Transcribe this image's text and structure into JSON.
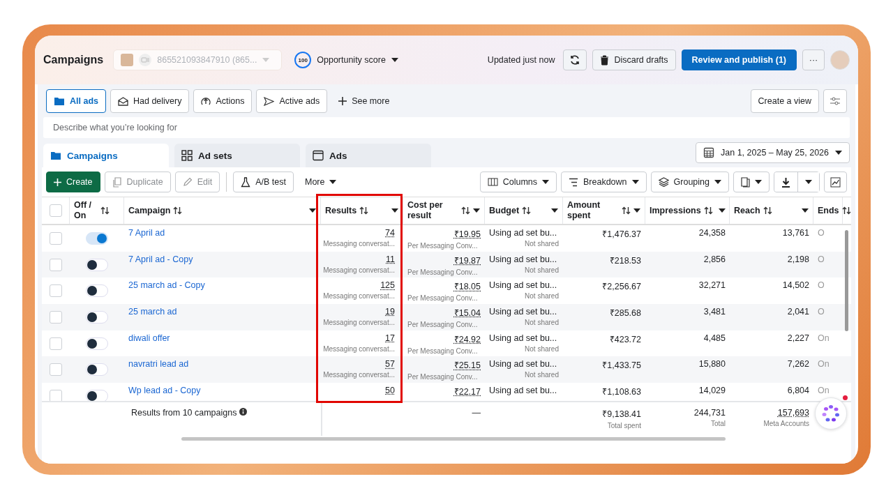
{
  "header": {
    "title": "Campaigns",
    "account": "865521093847910 (865...",
    "score_badge": "100",
    "score_label": "Opportunity score",
    "updated": "Updated just now",
    "discard": "Discard drafts",
    "publish": "Review and publish (1)",
    "more": "···"
  },
  "filters": [
    {
      "label": "All ads",
      "selected": true
    },
    {
      "label": "Had delivery",
      "selected": false
    },
    {
      "label": "Actions",
      "selected": false
    },
    {
      "label": "Active ads",
      "selected": false
    }
  ],
  "see_more": "See more",
  "create_view": "Create a view",
  "search": {
    "placeholder": "Describe what you’re looking for"
  },
  "level_tabs": [
    {
      "label": "Campaigns",
      "selected": true
    },
    {
      "label": "Ad sets",
      "selected": false
    },
    {
      "label": "Ads",
      "selected": false
    }
  ],
  "date_range": "Jan 1, 2025 – May 25, 2026",
  "toolbar": {
    "create": "Create",
    "duplicate": {
      "label": "Duplicate",
      "disabled": true
    },
    "edit": {
      "label": "Edit",
      "disabled": true
    },
    "ab_test": "A/B test",
    "more": "More",
    "columns": "Columns",
    "breakdown": "Breakdown",
    "grouping": "Grouping"
  },
  "table": {
    "select_all_checked": false,
    "columns": [
      "Off / On",
      "Campaign",
      "Results",
      "Cost per result",
      "Budget",
      "Amount spent",
      "Impressions",
      "Reach",
      "Ends"
    ],
    "rows": [
      {
        "checked": false,
        "on": true,
        "campaign": "7 April ad",
        "results": "74",
        "results_sub": "Messaging conversat...",
        "cost": "₹19.95",
        "cost_sub": "Per Messaging Conv...",
        "budget": "Using ad set bu...",
        "budget_sub": "Not shared",
        "amount": "₹1,476.37",
        "impressions": "24,358",
        "reach": "13,761",
        "ends": "O"
      },
      {
        "checked": false,
        "on": false,
        "campaign": "7 April ad - Copy",
        "results": "11",
        "results_sub": "Messaging conversat...",
        "cost": "₹19.87",
        "cost_sub": "Per Messaging Conv...",
        "budget": "Using ad set bu...",
        "budget_sub": "Not shared",
        "amount": "₹218.53",
        "impressions": "2,856",
        "reach": "2,198",
        "ends": "O"
      },
      {
        "checked": false,
        "on": false,
        "campaign": "25 march ad - Copy",
        "results": "125",
        "results_sub": "Messaging conversat...",
        "cost": "₹18.05",
        "cost_sub": "Per Messaging Conv...",
        "budget": "Using ad set bu...",
        "budget_sub": "Not shared",
        "amount": "₹2,256.67",
        "impressions": "32,271",
        "reach": "14,502",
        "ends": "O"
      },
      {
        "checked": false,
        "on": false,
        "campaign": "25 march ad",
        "results": "19",
        "results_sub": "Messaging conversat...",
        "cost": "₹15.04",
        "cost_sub": "Per Messaging Conv...",
        "budget": "Using ad set bu...",
        "budget_sub": "Not shared",
        "amount": "₹285.68",
        "impressions": "3,481",
        "reach": "2,041",
        "ends": "O"
      },
      {
        "checked": false,
        "on": false,
        "campaign": "diwali offer",
        "results": "17",
        "results_sub": "Messaging conversat...",
        "cost": "₹24.92",
        "cost_sub": "Per Messaging Conv...",
        "budget": "Using ad set bu...",
        "budget_sub": "Not shared",
        "amount": "₹423.72",
        "impressions": "4,485",
        "reach": "2,227",
        "ends": "On"
      },
      {
        "checked": false,
        "on": false,
        "campaign": "navratri lead ad",
        "results": "57",
        "results_sub": "Messaging conversat...",
        "cost": "₹25.15",
        "cost_sub": "Per Messaging Conv...",
        "budget": "Using ad set bu...",
        "budget_sub": "Not shared",
        "amount": "₹1,433.75",
        "impressions": "15,880",
        "reach": "7,262",
        "ends": "On"
      },
      {
        "checked": false,
        "on": false,
        "campaign": "Wp lead ad - Copy",
        "results": "50",
        "cost": "₹22.17",
        "budget": "Using ad set bu...",
        "amount": "₹1,108.63",
        "impressions": "14,029",
        "reach": "6,804",
        "ends": "On"
      }
    ],
    "footer": {
      "label": "Results from 10 campaigns",
      "cost": "—",
      "amount": "₹9,138.41",
      "amount_sub": "Total spent",
      "impressions": "244,731",
      "impressions_sub": "Total",
      "reach": "157,693",
      "reach_sub": "Meta Accounts"
    }
  }
}
